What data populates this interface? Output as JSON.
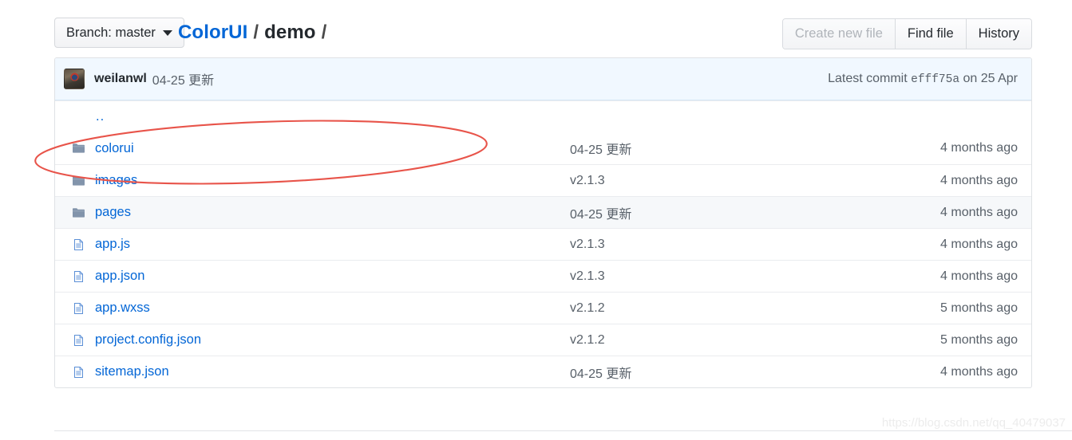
{
  "toolbar": {
    "branch_label": "Branch: master",
    "breadcrumb": {
      "repo": "ColorUI",
      "separator": "/",
      "directory": "demo",
      "trailing": "/"
    },
    "buttons": [
      {
        "label": "Create new file",
        "disabled": true
      },
      {
        "label": "Find file",
        "disabled": false
      },
      {
        "label": "History",
        "disabled": false
      }
    ]
  },
  "commit_bar": {
    "author": "weilanwl",
    "message": "04-25 更新",
    "latest_label": "Latest commit",
    "sha": "efff75a",
    "date": "on 25 Apr"
  },
  "files": {
    "parent_link": "..",
    "rows": [
      {
        "name": "colorui",
        "type": "folder",
        "message": "04-25 更新",
        "age": "4 months ago",
        "alt": false
      },
      {
        "name": "images",
        "type": "folder",
        "message": "v2.1.3",
        "age": "4 months ago",
        "alt": false
      },
      {
        "name": "pages",
        "type": "folder",
        "message": "04-25 更新",
        "age": "4 months ago",
        "alt": true
      },
      {
        "name": "app.js",
        "type": "file",
        "message": "v2.1.3",
        "age": "4 months ago",
        "alt": false
      },
      {
        "name": "app.json",
        "type": "file",
        "message": "v2.1.3",
        "age": "4 months ago",
        "alt": false
      },
      {
        "name": "app.wxss",
        "type": "file",
        "message": "v2.1.2",
        "age": "5 months ago",
        "alt": false
      },
      {
        "name": "project.config.json",
        "type": "file",
        "message": "v2.1.2",
        "age": "5 months ago",
        "alt": false
      },
      {
        "name": "sitemap.json",
        "type": "file",
        "message": "04-25 更新",
        "age": "4 months ago",
        "alt": false
      }
    ]
  },
  "annotation": {
    "shape": "ellipse",
    "color": "#e8544a",
    "target_row": "colorui"
  },
  "watermark": "https://blog.csdn.net/qq_40479037",
  "colors": {
    "link": "#0366d6",
    "muted": "#586069",
    "commit_bar_bg": "#f1f8ff",
    "row_alt_bg": "#f6f8fa",
    "folder_icon": "#8294ab"
  }
}
